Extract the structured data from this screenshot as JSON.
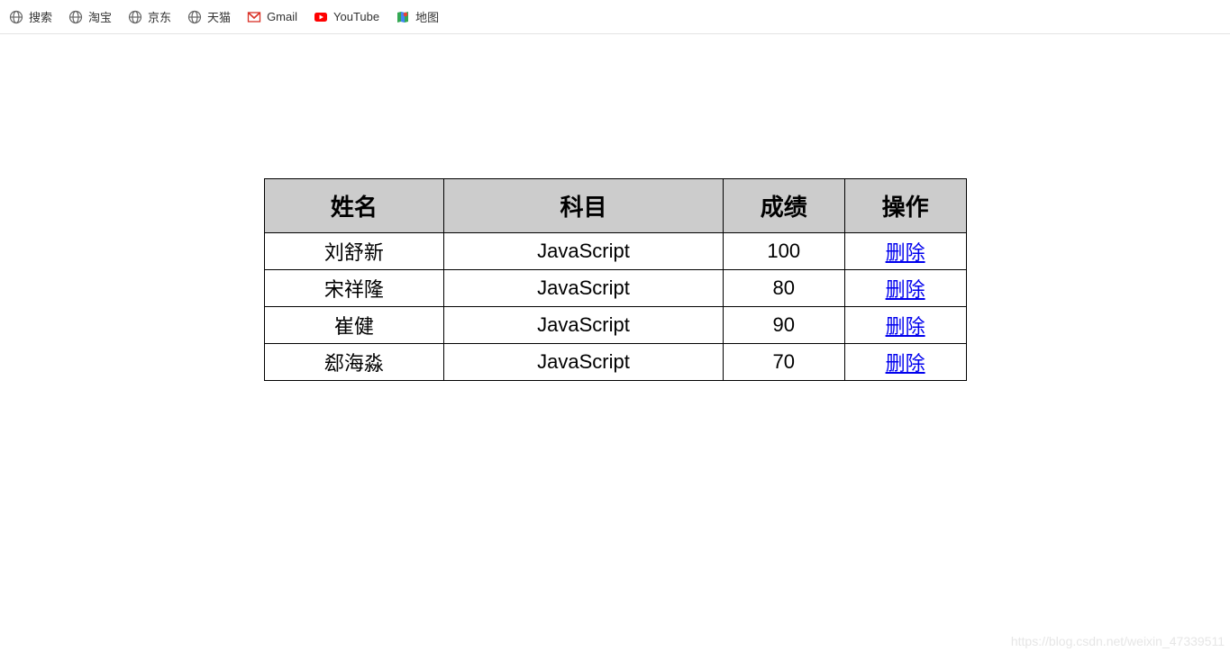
{
  "bookmarks": [
    {
      "icon": "globe",
      "label": "搜索"
    },
    {
      "icon": "globe",
      "label": "淘宝"
    },
    {
      "icon": "globe",
      "label": "京东"
    },
    {
      "icon": "globe",
      "label": "天猫"
    },
    {
      "icon": "gmail",
      "label": "Gmail"
    },
    {
      "icon": "youtube",
      "label": "YouTube"
    },
    {
      "icon": "maps",
      "label": "地图"
    }
  ],
  "table": {
    "headers": {
      "name": "姓名",
      "subject": "科目",
      "score": "成绩",
      "action": "操作"
    },
    "rows": [
      {
        "name": "刘舒新",
        "subject": "JavaScript",
        "score": "100",
        "action": "删除"
      },
      {
        "name": "宋祥隆",
        "subject": "JavaScript",
        "score": "80",
        "action": "删除"
      },
      {
        "name": "崔健",
        "subject": "JavaScript",
        "score": "90",
        "action": "删除"
      },
      {
        "name": "郄海淼",
        "subject": "JavaScript",
        "score": "70",
        "action": "删除"
      }
    ]
  },
  "watermark": "https://blog.csdn.net/weixin_47339511"
}
